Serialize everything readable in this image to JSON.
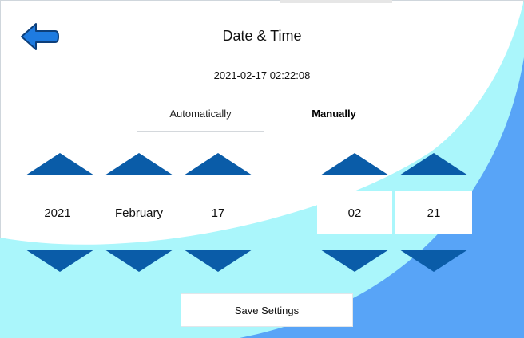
{
  "header": {
    "title": "Date & Time",
    "back_icon": "arrow-left-icon"
  },
  "current_datetime": "2021-02-17 02:22:08",
  "mode": {
    "automatic_label": "Automatically",
    "manual_label": "Manually",
    "selected": "Manually"
  },
  "date": {
    "year": "2021",
    "month": "February",
    "day": "17"
  },
  "time": {
    "hour": "02",
    "minute": "21"
  },
  "save_label": "Save Settings",
  "colors": {
    "arrow_blue": "#0a5ca8",
    "light_cyan": "#aaf6fb",
    "mid_blue": "#58a4f7",
    "back_icon_blue": "#1e7be0"
  }
}
